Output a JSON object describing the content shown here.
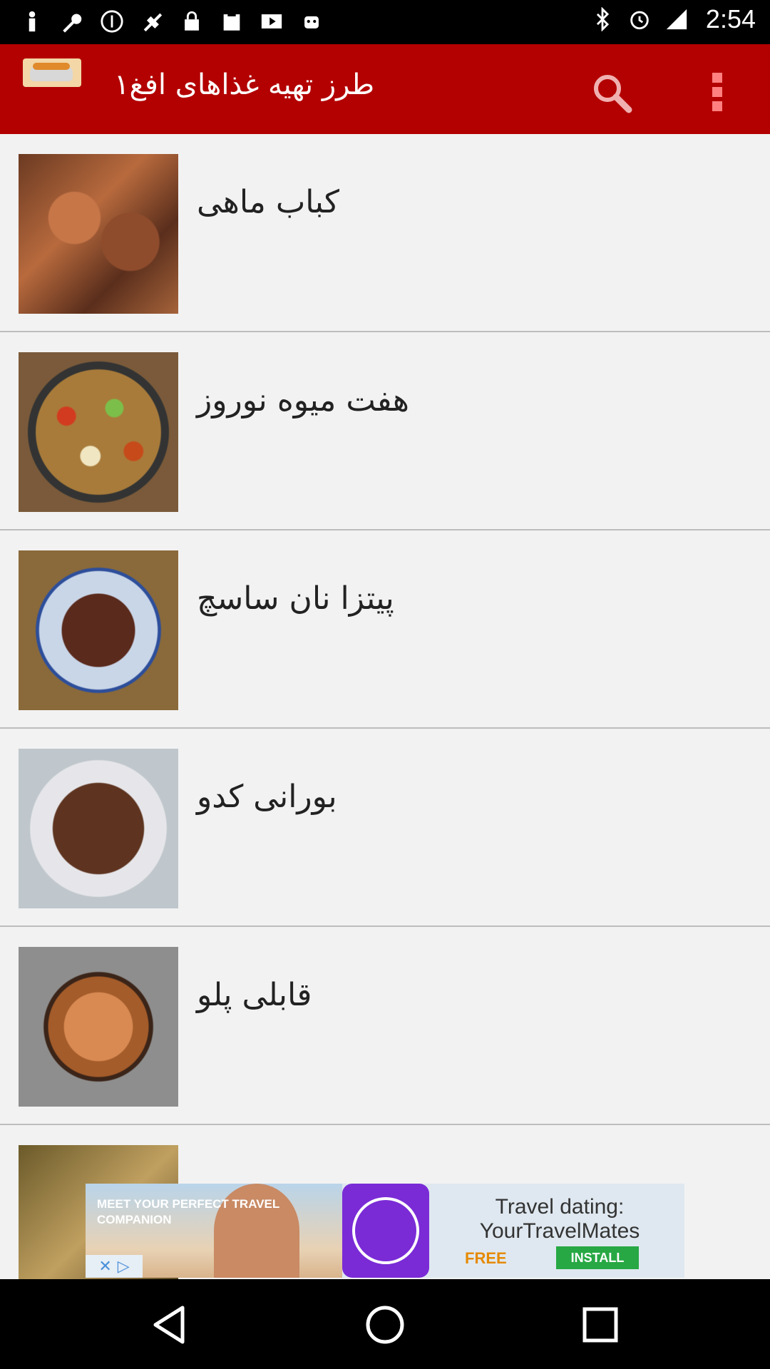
{
  "status_bar": {
    "time": "2:54",
    "left_icons": [
      "notification-icon",
      "wrench-icon",
      "info-icon",
      "satellite-icon",
      "lock-icon",
      "clipboard-icon",
      "play-icon",
      "android-icon"
    ],
    "right_icons": [
      "bluetooth-icon",
      "alarm-icon",
      "signal-icon"
    ]
  },
  "app_bar": {
    "title": "طرز تهیه غذاهای افغ۱",
    "accent": "#b30000"
  },
  "list": {
    "items": [
      {
        "label": "کباب ماهی"
      },
      {
        "label": "هفت میوه نوروز"
      },
      {
        "label": "پیتزا نان ساسچ"
      },
      {
        "label": "بورانی کدو"
      },
      {
        "label": "قابلی پلو"
      },
      {
        "label": ""
      }
    ]
  },
  "ad": {
    "tagline": "MEET YOUR PERFECT TRAVEL COMPANION",
    "headline": "Travel dating: YourTravelMates",
    "price": "FREE",
    "cta": "INSTALL"
  }
}
